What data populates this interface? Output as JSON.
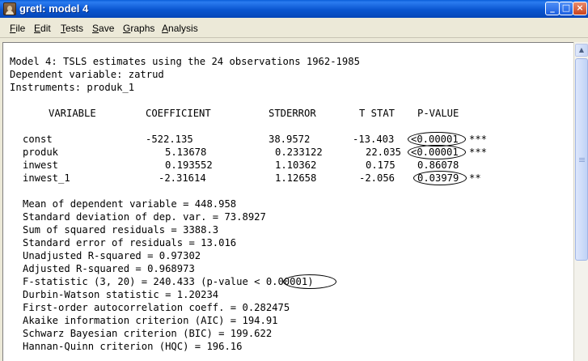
{
  "window": {
    "title": "gretl: model 4"
  },
  "menu": [
    {
      "id": "file",
      "label": "File",
      "hotkey_index": 0
    },
    {
      "id": "edit",
      "label": "Edit",
      "hotkey_index": 0
    },
    {
      "id": "tests",
      "label": "Tests",
      "hotkey_index": 0
    },
    {
      "id": "save",
      "label": "Save",
      "hotkey_index": 0
    },
    {
      "id": "graphs",
      "label": "Graphs",
      "hotkey_index": 0
    },
    {
      "id": "analysis",
      "label": "Analysis",
      "hotkey_index": 0
    }
  ],
  "output": {
    "header": [
      "Model 4: TSLS estimates using the 24 observations 1962-1985",
      "Dependent variable: zatrud",
      "Instruments: produk_1"
    ],
    "columns": [
      "VARIABLE",
      "COEFFICIENT",
      "STDERROR",
      "T STAT",
      "P-VALUE"
    ],
    "rows": [
      {
        "variable": "const",
        "coefficient": "-522.135",
        "stderror": "38.9572",
        "tstat": "-13.403",
        "pvalue": "<0.00001",
        "stars": "***"
      },
      {
        "variable": "produk",
        "coefficient": "5.13678",
        "stderror": "0.233122",
        "tstat": "22.035",
        "pvalue": "<0.00001",
        "stars": "***"
      },
      {
        "variable": "inwest",
        "coefficient": "0.193552",
        "stderror": "1.10362",
        "tstat": "0.175",
        "pvalue": "0.86078",
        "stars": ""
      },
      {
        "variable": "inwest_1",
        "coefficient": "-2.31614",
        "stderror": "1.12658",
        "tstat": "-2.056",
        "pvalue": "0.03979",
        "stars": "**"
      }
    ],
    "stats": [
      "Mean of dependent variable = 448.958",
      "Standard deviation of dep. var. = 73.8927",
      "Sum of squared residuals = 3388.3",
      "Standard error of residuals = 13.016",
      "Unadjusted R-squared = 0.97302",
      "Adjusted R-squared = 0.968973",
      "F-statistic (3, 20) = 240.433 (p-value < 0.00001)",
      "Durbin-Watson statistic = 1.20234",
      "First-order autocorrelation coeff. = 0.282475",
      "Akaike information criterion (AIC) = 194.91",
      "Schwarz Bayesian criterion (BIC) = 199.622",
      "Hannan-Quinn criterion (HQC) = 196.16"
    ]
  }
}
